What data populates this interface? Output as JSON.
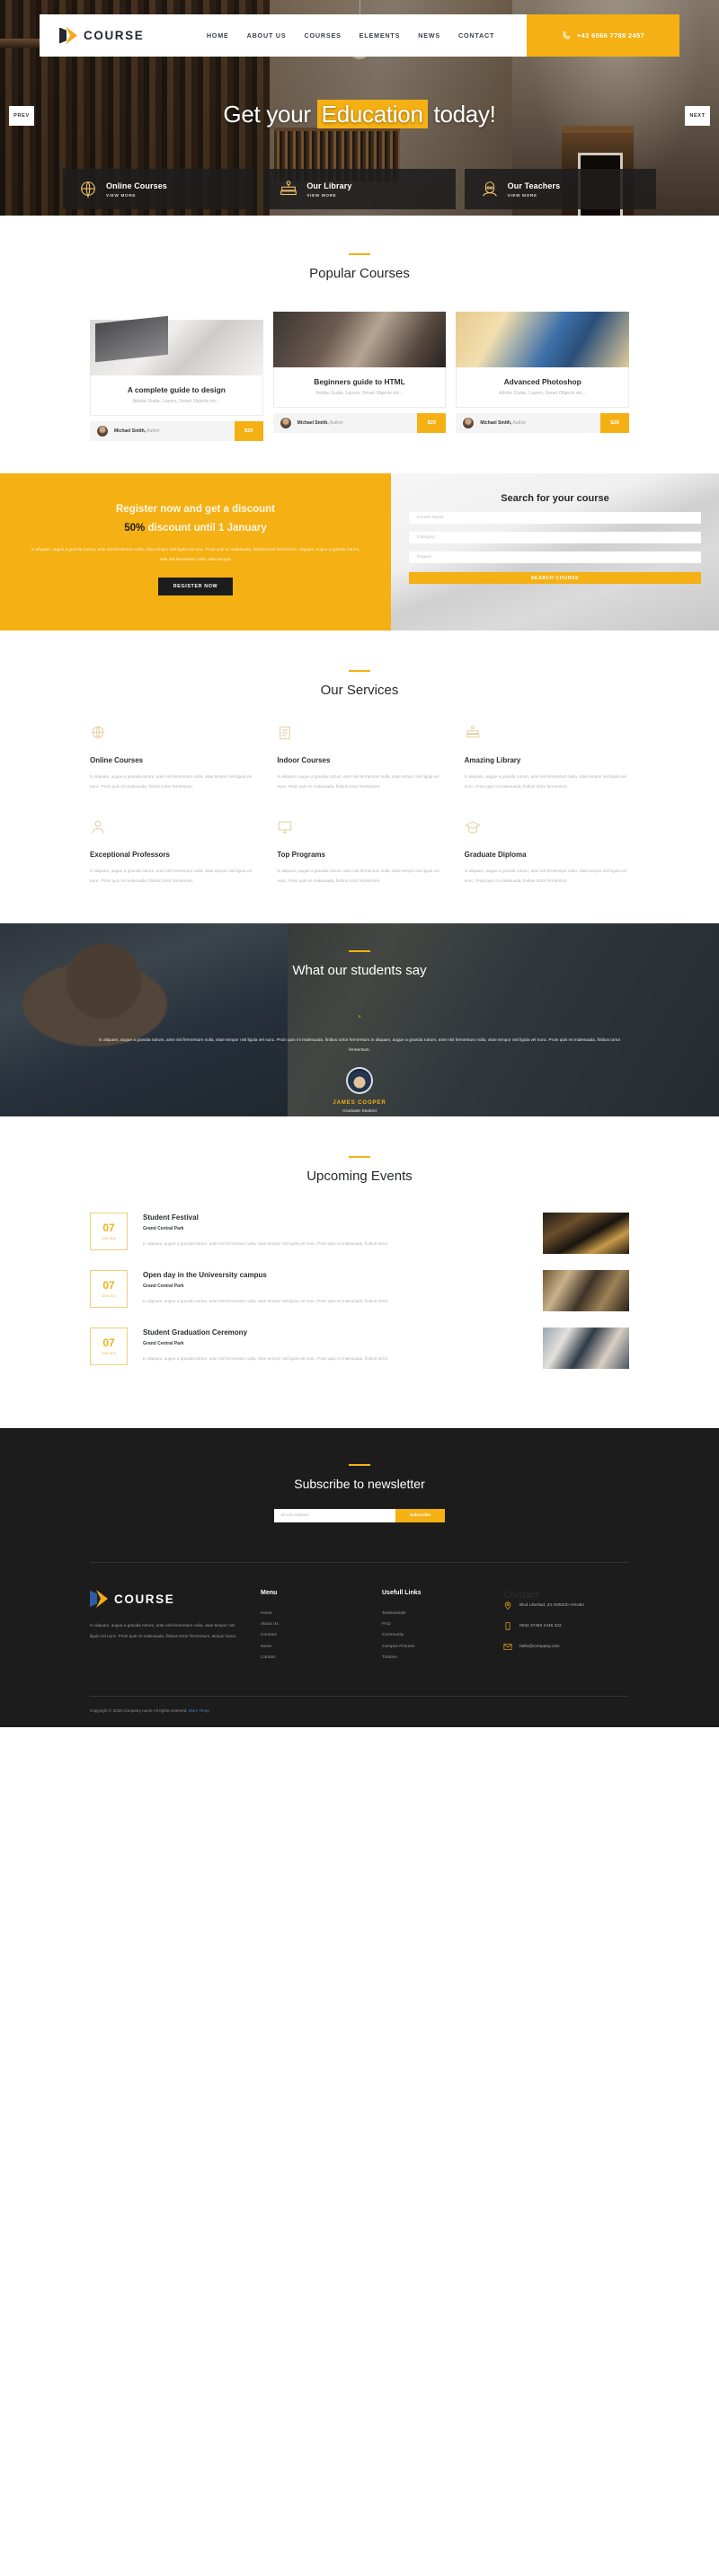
{
  "brand": {
    "name": "COURSE"
  },
  "nav": {
    "items": [
      {
        "label": "HOME"
      },
      {
        "label": "ABOUT US"
      },
      {
        "label": "COURSES"
      },
      {
        "label": "ELEMENTS"
      },
      {
        "label": "NEWS"
      },
      {
        "label": "CONTACT"
      }
    ],
    "phone": "+43 6566 7788 2457"
  },
  "hero": {
    "headline_before": "Get your",
    "headline_highlight": "Education",
    "headline_after": "today!",
    "prev": "PREV",
    "next": "NEXT",
    "boxes": [
      {
        "title": "Online Courses",
        "more": "VIEW MORE",
        "icon": "globe-icon"
      },
      {
        "title": "Our Library",
        "more": "VIEW MORE",
        "icon": "books-icon"
      },
      {
        "title": "Our Teachers",
        "more": "VIEW MORE",
        "icon": "teacher-icon"
      }
    ]
  },
  "popular": {
    "title": "Popular Courses",
    "cards": [
      {
        "title": "A complete guide to design",
        "subtitle": "Adobe Guide, Layers, Smart Objects etc...",
        "author": "Michael Smith,",
        "author_role": " Author",
        "price": "$29"
      },
      {
        "title": "Beginners guide to HTML",
        "subtitle": "Adobe Guide, Layers, Smart Objects etc...",
        "author": "Michael Smith,",
        "author_role": " Author",
        "price": "$29"
      },
      {
        "title": "Advanced Photoshop",
        "subtitle": "Adobe Guide, Layers, Smart Objects etc...",
        "author": "Michael Smith,",
        "author_role": " Author",
        "price": "$29"
      }
    ]
  },
  "promo": {
    "line1": "Register now and get a discount",
    "line2_strong": "50%",
    "line2_rest": " discount until 1 January",
    "body": "In aliquam, augue a gravida rutrum, ante nisl fermentum nulla, vitae tempor nisl ligula vel nunc. Proin quis mi malesuada, finibus tortor fermentum. Aliquam, augue a gravida rutrum, ante nisl fermentum nulla, vitae tempor.",
    "cta": "REGISTER NOW"
  },
  "search": {
    "title": "Search for your course",
    "course_name_placeholder": "Course Name",
    "category_placeholder": "Category",
    "degree_placeholder": "Degree",
    "button": "SEARCH COURSE"
  },
  "services": {
    "title": "Our Services",
    "body": "In aliquam, augue a gravida rutrum, ante nisl fermentum nulla, vitae tempor nisl ligula vel nunc. Proin quis mi malesuada, finibus tortor fermentum.",
    "items": [
      {
        "title": "Online Courses",
        "icon": "globe-icon"
      },
      {
        "title": "Indoor Courses",
        "icon": "document-icon"
      },
      {
        "title": "Amazing Library",
        "icon": "books-icon"
      },
      {
        "title": "Exceptional Professors",
        "icon": "professor-icon"
      },
      {
        "title": "Top Programs",
        "icon": "monitor-icon"
      },
      {
        "title": "Graduate Diploma",
        "icon": "graduation-cap-icon"
      }
    ]
  },
  "testimonials": {
    "title": "What our students say",
    "quote": "In aliquam, augue a gravida rutrum, ante nisl fermentum nulla, vitae tempor nisl ligula vel nunc. Proin quis mi malesuada, finibus tortor fermentum.In aliquam, augue a gravida rutrum, ante nisl fermentum nulla, vitae tempor nisl ligula vel nunc. Proin quis mi malesuada, finibus tortor fermentum.",
    "name": "JAMES COOPER",
    "role": "Graduate Student"
  },
  "events": {
    "title": "Upcoming Events",
    "items": [
      {
        "day": "07",
        "month": "January",
        "title": "Student Festival",
        "location": "Grand Central Park",
        "body": "In aliquam, augue a gravida rutrum, ante nisl fermentum nulla, vitae tempor nisl ligula vel nunc. Proin quis mi malesuada, finibus tortor"
      },
      {
        "day": "07",
        "month": "January",
        "title": "Open day in the Univesrsity campus",
        "location": "Grand Central Park",
        "body": "In aliquam, augue a gravida rutrum, ante nisl fermentum nulla, vitae tempor nisl ligula vel nunc. Proin quis mi malesuada, finibus tortor"
      },
      {
        "day": "07",
        "month": "January",
        "title": "Student Graduation Ceremony",
        "location": "Grand Central Park",
        "body": "In aliquam, augue a gravida rutrum, ante nisl fermentum nulla, vitae tempor nisl ligula vel nunc. Proin quis mi malesuada, finibus tortor"
      }
    ]
  },
  "newsletter": {
    "title": "Subscribe to newsletter",
    "placeholder": "Email Address",
    "button": "Subscribe"
  },
  "footer": {
    "about": "In aliquam, augue a gravida rutrum, ante nisl fermentum nulla, vitae tempor nisl ligulo vel nunc. Proin quis mi malesuada, finibus tortor fermentum, tempor lacus.",
    "menu_title": "Menu",
    "menu": [
      {
        "label": "Home"
      },
      {
        "label": "About Us"
      },
      {
        "label": "Courses"
      },
      {
        "label": "News"
      },
      {
        "label": "Contact"
      }
    ],
    "links_title": "Usefull Links",
    "links": [
      {
        "label": "Testimonials"
      },
      {
        "label": "FAQ"
      },
      {
        "label": "Community"
      },
      {
        "label": "Campus Pictures"
      },
      {
        "label": "Tuitions"
      }
    ],
    "contact_title": "Contact",
    "address": "Blvd Libertad, 34 m05200 Arévalo",
    "phone": "0034 37483 2445 322",
    "email": "hello@company.com",
    "copyright_text": "Copyright © 2018 Company name All rights reserved.",
    "copyright_credit": "More Temp",
    "socials": [
      {
        "name": "pinterest-icon"
      },
      {
        "name": "linkedin-icon"
      },
      {
        "name": "instagram-icon"
      },
      {
        "name": "facebook-icon"
      },
      {
        "name": "twitter-icon"
      }
    ]
  },
  "colors": {
    "accent": "#f5b014",
    "dark": "#1c1c1c"
  }
}
